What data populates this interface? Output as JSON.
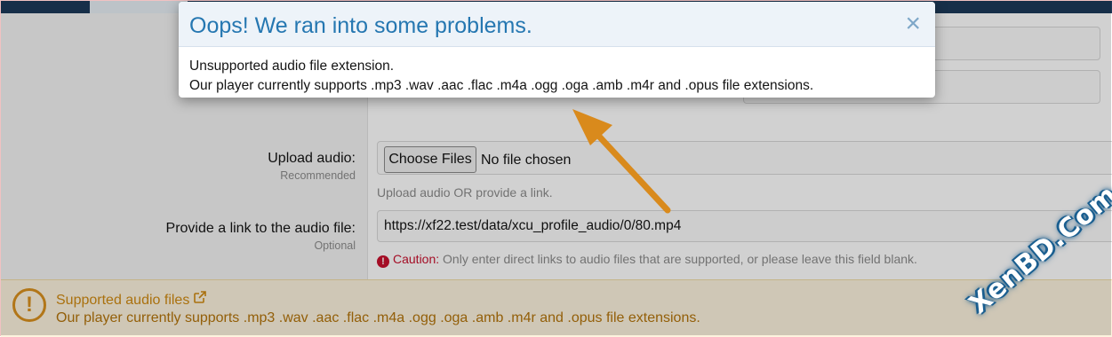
{
  "modal": {
    "title": "Oops! We ran into some problems.",
    "close_icon": "×",
    "message_line1": "Unsupported audio file extension.",
    "message_line2": "Our player currently supports .mp3 .wav .aac .flac .m4a .ogg .oga .amb .m4r and .opus file extensions."
  },
  "form": {
    "upload_label": "Upload audio:",
    "upload_sublabel": "Recommended",
    "choose_files_label": "Choose Files",
    "no_file_text": "No file chosen",
    "upload_hint": "Upload audio OR provide a link.",
    "link_label": "Provide a link to the audio file:",
    "link_sublabel": "Optional",
    "link_value": "https://xf22.test/data/xcu_profile_audio/0/80.mp4",
    "caution_label": "Caution:",
    "caution_text": "Only enter direct links to audio files that are supported, or please leave this field blank."
  },
  "notice": {
    "icon": "!",
    "link_text": "Supported audio files",
    "text": "Our player currently supports .mp3 .wav .aac .flac .m4a .ogg .oga .amb .m4r and .opus file extensions."
  },
  "watermark": "XenBD.Com",
  "colors": {
    "modal_title": "#2577b1",
    "notice_bg": "#fdf3de",
    "notice_text": "#b4740b",
    "caution": "#c8102e",
    "arrow": "#d98a1c"
  }
}
